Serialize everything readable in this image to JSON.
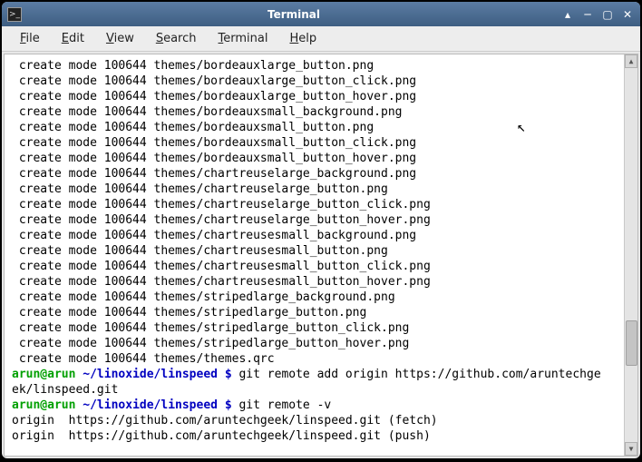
{
  "window": {
    "title": "Terminal",
    "icon_glyph": ">_"
  },
  "menubar": [
    {
      "accel": "F",
      "rest": "ile"
    },
    {
      "accel": "E",
      "rest": "dit"
    },
    {
      "accel": "V",
      "rest": "iew"
    },
    {
      "accel": "S",
      "rest": "earch"
    },
    {
      "accel": "T",
      "rest": "erminal"
    },
    {
      "accel": "H",
      "rest": "elp"
    }
  ],
  "files": [
    "themes/bordeauxlarge_button.png",
    "themes/bordeauxlarge_button_click.png",
    "themes/bordeauxlarge_button_hover.png",
    "themes/bordeauxsmall_background.png",
    "themes/bordeauxsmall_button.png",
    "themes/bordeauxsmall_button_click.png",
    "themes/bordeauxsmall_button_hover.png",
    "themes/chartreuselarge_background.png",
    "themes/chartreuselarge_button.png",
    "themes/chartreuselarge_button_click.png",
    "themes/chartreuselarge_button_hover.png",
    "themes/chartreusesmall_background.png",
    "themes/chartreusesmall_button.png",
    "themes/chartreusesmall_button_click.png",
    "themes/chartreusesmall_button_hover.png",
    "themes/stripedlarge_background.png",
    "themes/stripedlarge_button.png",
    "themes/stripedlarge_button_click.png",
    "themes/stripedlarge_button_hover.png",
    "themes/themes.qrc"
  ],
  "mode_prefix": " create mode 100644 ",
  "prompt": {
    "user_host": "arun@arun ",
    "path": "~/linoxide/linspeed $",
    "cmd1": " git remote add origin https://github.com/aruntechge",
    "cmd1_wrap": "ek/linspeed.git",
    "cmd2": " git remote -v"
  },
  "remote_out": {
    "line1": "origin  https://github.com/aruntechgeek/linspeed.git (fetch)",
    "line2": "origin  https://github.com/aruntechgeek/linspeed.git (push)"
  }
}
